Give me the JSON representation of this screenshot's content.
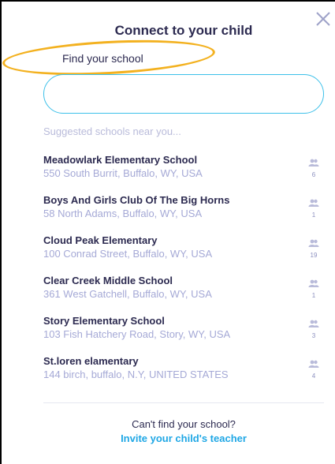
{
  "dialog": {
    "title": "Connect to your child",
    "field_label": "Find your school",
    "search_placeholder": "",
    "search_value": "",
    "suggested_label": "Suggested schools near you...",
    "cant_find": "Can't find your school?",
    "invite_link": "Invite your child's teacher",
    "close_icon": "close-icon",
    "count_icon": "people-icon"
  },
  "schools": [
    {
      "name": "Meadowlark Elementary School",
      "address": "550 South Burrit, Buffalo, WY, USA",
      "count": "6"
    },
    {
      "name": "Boys And Girls Club Of The Big Horns",
      "address": "58 North Adams, Buffalo, WY, USA",
      "count": "1"
    },
    {
      "name": "Cloud Peak Elementary",
      "address": "100 Conrad Street, Buffalo, WY, USA",
      "count": "19"
    },
    {
      "name": "Clear Creek Middle School",
      "address": "361 West Gatchell, Buffalo, WY, USA",
      "count": "1"
    },
    {
      "name": "Story Elementary School",
      "address": "103 Fish Hatchery Road, Story, WY, USA",
      "count": "3"
    },
    {
      "name": "St.loren elamentary",
      "address": "144 birch, buffalo, N.Y, UNITED STATES",
      "count": "4"
    }
  ],
  "colors": {
    "title": "#2c2a50",
    "accent": "#1fa7e5",
    "input_border": "#3cc0e9",
    "muted": "#a5a9d6",
    "highlight": "#f3b11f"
  }
}
